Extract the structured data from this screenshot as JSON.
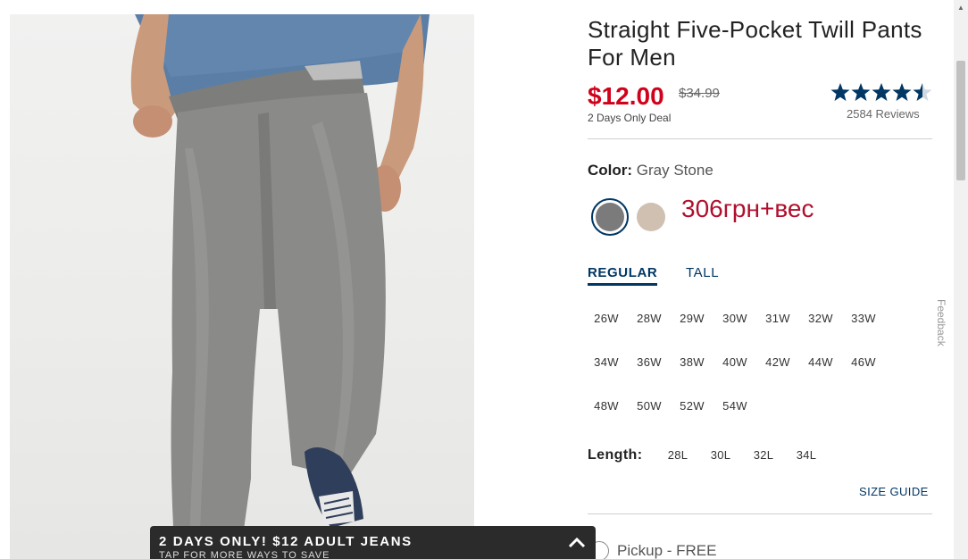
{
  "product": {
    "title": "Straight Five-Pocket Twill Pants For Men",
    "sale_price": "$12.00",
    "original_price": "$34.99",
    "deal_text": "2 Days Only Deal",
    "rating": 4.5,
    "reviews": "2584 Reviews",
    "color_label": "Color:",
    "color_value": "Gray Stone",
    "annotation": "306грн+вес"
  },
  "swatches": [
    {
      "name": "Gray Stone",
      "color": "#7b7b7b",
      "selected": true
    },
    {
      "name": "Khaki",
      "color": "#cfc0b1",
      "selected": false
    }
  ],
  "fit_tabs": [
    "REGULAR",
    "TALL"
  ],
  "waist_sizes": [
    "26W",
    "28W",
    "29W",
    "30W",
    "31W",
    "32W",
    "33W",
    "34W",
    "36W",
    "38W",
    "40W",
    "42W",
    "44W",
    "46W",
    "48W",
    "50W",
    "52W",
    "54W"
  ],
  "length_label": "Length:",
  "length_sizes": [
    "28L",
    "30L",
    "32L",
    "34L"
  ],
  "size_guide": "SIZE GUIDE",
  "pickup": "Pickup - FREE",
  "feedback": "Feedback",
  "promo": {
    "headline": "2 DAYS ONLY! $12 ADULT JEANS",
    "subtext": "TAP FOR MORE WAYS TO SAVE"
  },
  "colors": {
    "sale": "#d0021b",
    "navy": "#003764",
    "annotation": "#b0102d"
  }
}
